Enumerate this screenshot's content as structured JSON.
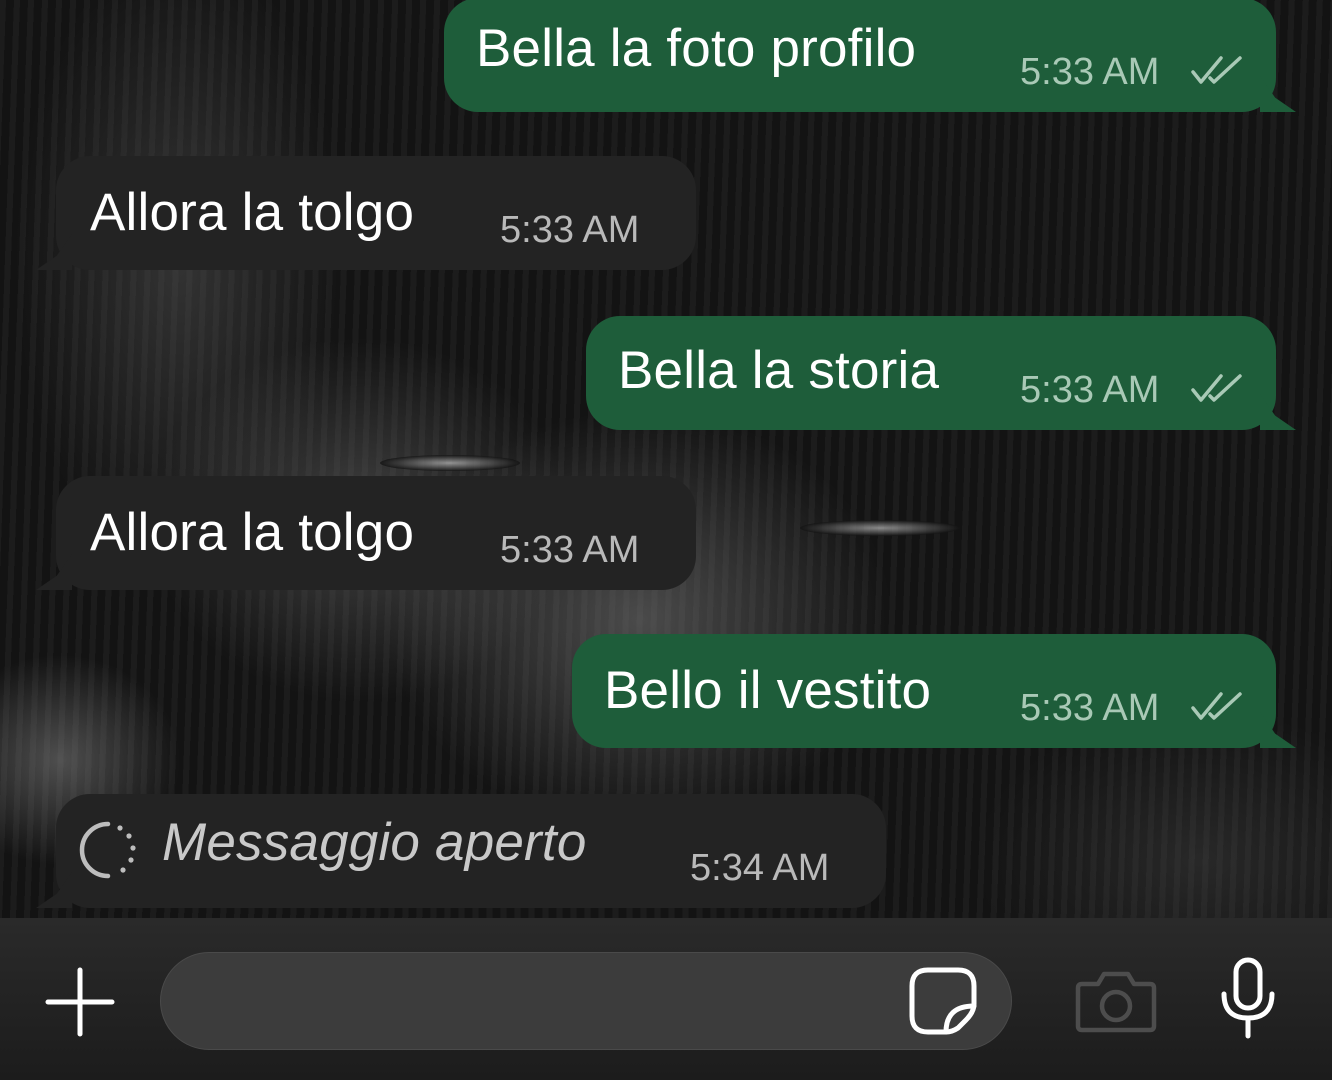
{
  "conversation": {
    "messages": [
      {
        "direction": "out",
        "text": "Bella la foto profilo",
        "time": "5:33 AM",
        "status": "read-ticks"
      },
      {
        "direction": "in",
        "text": "Allora la tolgo",
        "time": "5:33 AM"
      },
      {
        "direction": "out",
        "text": "Bella la storia",
        "time": "5:33 AM",
        "status": "read-ticks"
      },
      {
        "direction": "in",
        "text": "Allora la tolgo",
        "time": "5:33 AM"
      },
      {
        "direction": "out",
        "text": "Bello il vestito",
        "time": "5:33 AM",
        "status": "read-ticks"
      },
      {
        "direction": "in",
        "text": "Messaggio aperto",
        "time": "5:34 AM",
        "icon": "view-once-opened-icon"
      }
    ]
  },
  "composer": {
    "placeholder": "",
    "icons": [
      "plus-icon",
      "sticker-icon",
      "camera-icon",
      "microphone-icon"
    ]
  },
  "colors": {
    "outgoing_bubble": "#1e5d3a",
    "incoming_bubble": "#232323",
    "background": "#0b0b0b",
    "input_bar": "#2a2a2a"
  }
}
